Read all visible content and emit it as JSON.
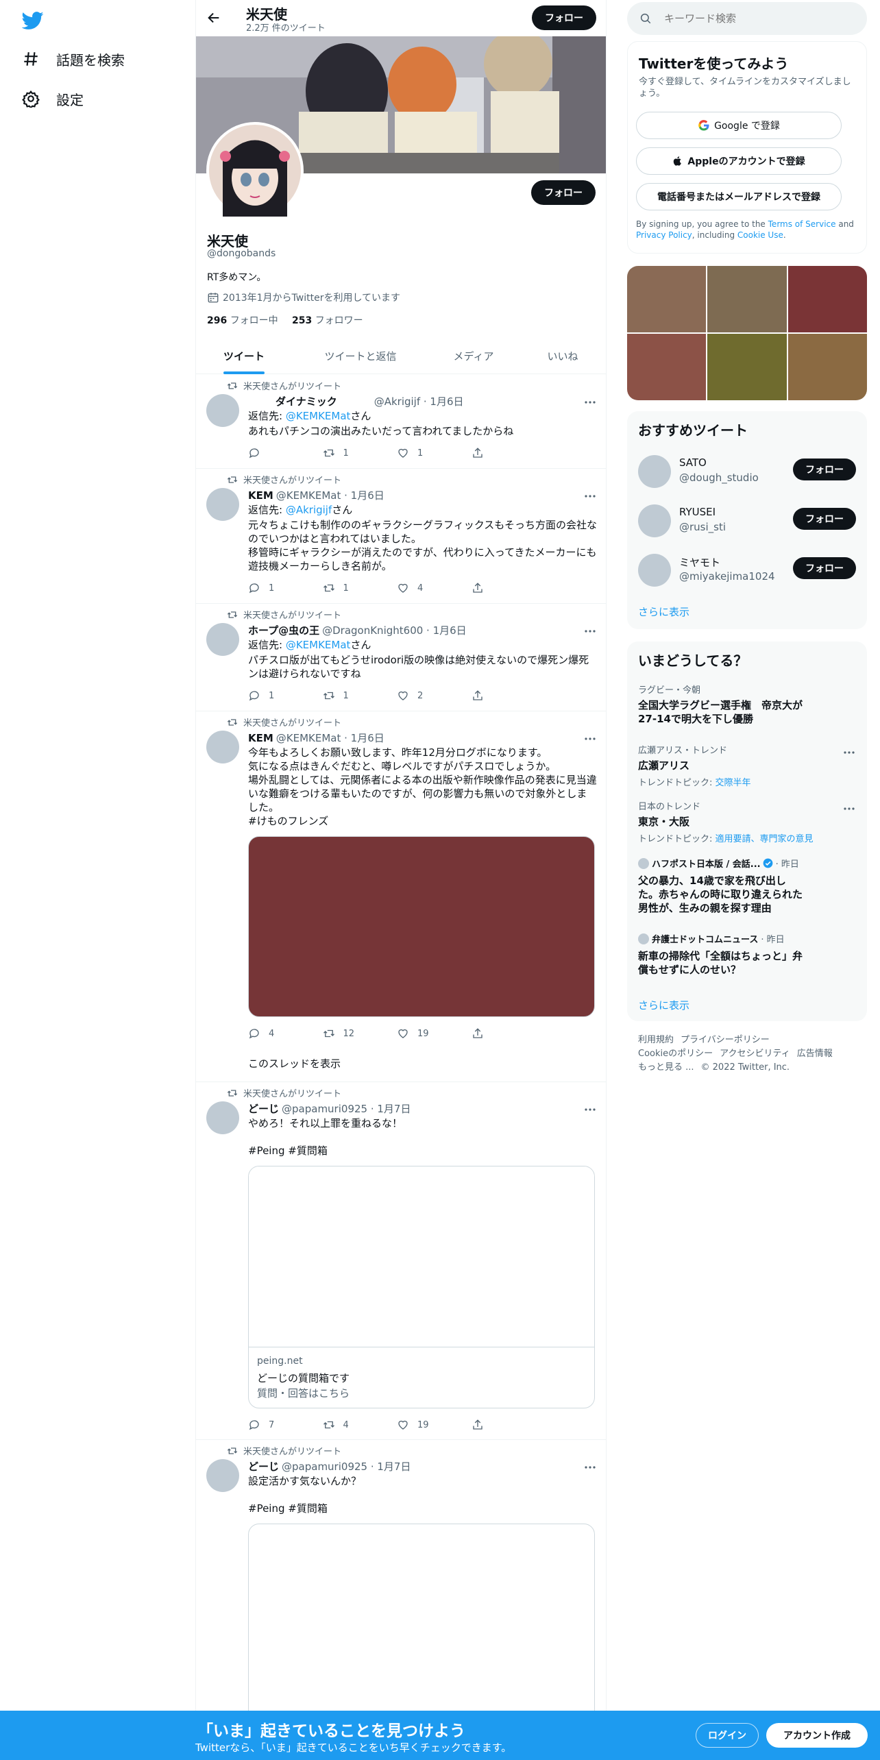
{
  "nav": {
    "explore_label": "話題を検索",
    "settings_label": "設定"
  },
  "header": {
    "title": "米天使",
    "subtitle": "2.2万 件のツイート",
    "follow_label": "フォロー"
  },
  "profile": {
    "name": "米天使",
    "handle": "@dongobands",
    "bio": "RT多めマン。",
    "joined": "2013年1月からTwitterを利用しています",
    "following_count": "296",
    "following_label": "フォロー中",
    "followers_count": "253",
    "followers_label": "フォロワー",
    "follow_label": "フォロー"
  },
  "tabs": [
    "ツイート",
    "ツイートと返信",
    "メディア",
    "いいね"
  ],
  "retweet_label": "米天使さんがリツイート",
  "tweets": [
    {
      "name": "ダイナミック",
      "handle": "@Akrigijf · 1月6日",
      "reply_prefix": "返信先: ",
      "reply_to": "@KEMKEMat",
      "reply_suffix": "さん",
      "text": "あれもパチンコの演出みたいだって言われてましたからね",
      "replies": "",
      "retweets": "1",
      "likes": "1"
    },
    {
      "name": "KEM",
      "handle": "@KEMKEMat · 1月6日",
      "reply_prefix": "返信先: ",
      "reply_to": "@Akrigijf",
      "reply_suffix": "さん",
      "text": "元々ちょこけも制作ののギャラクシーグラフィックスもそっち方面の会社なのでいつかはと言われてはいました。\n移管時にギャラクシーが消えたのですが、代わりに入ってきたメーカーにも遊技機メーカーらしき名前が。",
      "replies": "1",
      "retweets": "1",
      "likes": "4"
    },
    {
      "name": "ホープ@虫の王",
      "handle": "@DragonKnight600 · 1月6日",
      "reply_prefix": "返信先: ",
      "reply_to": "@KEMKEMat",
      "reply_suffix": "さん",
      "text": "パチスロ版が出てもどうせirodori版の映像は絶対使えないので爆死ン爆死ンは避けられないですね",
      "replies": "1",
      "retweets": "1",
      "likes": "2"
    },
    {
      "name": "KEM",
      "handle": "@KEMKEMat · 1月6日",
      "text": "今年もよろしくお願い致します、昨年12月分ログボになります。\n気になる点はきんぐだむと、噂レベルですがパチスロでしょうか。\n場外乱闘としては、元関係者による本の出版や新作映像作品の発表に見当違いな難癖をつける輩もいたのですが、何の影響力も無いので対象外としました。",
      "hashtag": "#けものフレンズ",
      "replies": "4",
      "retweets": "12",
      "likes": "19",
      "thread_link": "このスレッドを表示"
    },
    {
      "name": "どーじ",
      "handle": "@papamuri0925 · 1月7日",
      "text": "やめろ！それ以上罪を重ねるな！",
      "hashtags": "#Peing #質問箱",
      "card_domain": "peing.net",
      "card_title": "どーじの質問箱です",
      "card_desc": "質問・回答はこちら",
      "replies": "7",
      "retweets": "4",
      "likes": "19"
    },
    {
      "name": "どーじ",
      "handle": "@papamuri0925 · 1月7日",
      "text": "設定活かす気ないんか？",
      "hashtags": "#Peing #質問箱"
    }
  ],
  "search": {
    "placeholder": "キーワード検索"
  },
  "signup": {
    "title": "Twitterを使ってみよう",
    "subtitle": "今すぐ登録して、タイムラインをカスタマイズしましょう。",
    "google_label": "Google で登録",
    "apple_label": "Appleのアカウントで登録",
    "phone_label": "電話番号またはメールアドレスで登録",
    "legal_pre": "By signing up, you agree to the ",
    "terms": "Terms of Service",
    "and": " and ",
    "privacy": "Privacy Policy",
    "including": ", including ",
    "cookie": "Cookie Use",
    "period": "."
  },
  "media_colors": [
    "#8a6a55",
    "#7e6b52",
    "#7a3436",
    "#8c5247",
    "#6f6b2e",
    "#8b6a42"
  ],
  "who_to_follow": {
    "title": "おすすめツイート",
    "users": [
      {
        "name": "SATO",
        "handle": "@dough_studio"
      },
      {
        "name": "RYUSEI",
        "handle": "@rusi_sti"
      },
      {
        "name": "ミヤモト",
        "handle": "@miyakejima1024"
      }
    ],
    "follow_label": "フォロー",
    "show_more": "さらに表示"
  },
  "trends": {
    "title": "いまどうしてる？",
    "items": [
      {
        "meta": "ラグビー・今朝",
        "title": "全国大学ラグビー選手権　帝京大が27-14で明大を下し優勝"
      },
      {
        "meta": "広瀬アリス・トレンド",
        "title": "広瀬アリス",
        "sub_label": "トレンドトピック: ",
        "sub_link": "交際半年"
      },
      {
        "meta": "日本のトレンド",
        "title": "東京・大阪",
        "sub_label": "トレンドトピック: ",
        "sub_link": "適用要請、専門家の意見"
      },
      {
        "source": "ハフポスト日本版 / 会話...",
        "time": "· 昨日",
        "title": "父の暴力、14歳で家を飛び出した。赤ちゃんの時に取り違えられた男性が、生みの親を探す理由"
      },
      {
        "source": "弁護士ドットコムニュース",
        "time": "· 昨日",
        "title": "新車の掃除代「全額はちょっと」弁償もせずに人のせい？"
      }
    ],
    "show_more": "さらに表示"
  },
  "footer": {
    "links": [
      "利用規約",
      "プライバシーポリシー",
      "Cookieのポリシー",
      "アクセシビリティ",
      "広告情報",
      "もっと見る ..."
    ],
    "copyright": "© 2022 Twitter, Inc."
  },
  "banner": {
    "title": "「いま」起きていることを見つけよう",
    "subtitle": "Twitterなら、「いま」起きていることをいち早くチェックできます。",
    "login_label": "ログイン",
    "signup_label": "アカウント作成"
  }
}
